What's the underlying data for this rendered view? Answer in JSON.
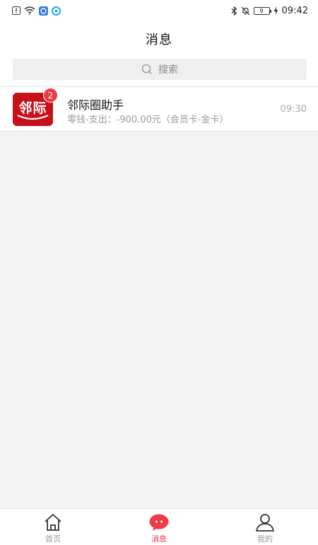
{
  "status_bar": {
    "time": "09:42",
    "battery": "9"
  },
  "header": {
    "title": "消息"
  },
  "search": {
    "placeholder": "搜索"
  },
  "messages": [
    {
      "avatar_text": "邻际",
      "badge": "2",
      "title": "邻际圈助手",
      "preview": "零钱-支出：-900.00元（会员卡-金卡）",
      "time": "09:30"
    }
  ],
  "tabs": [
    {
      "label": "首页",
      "icon": "home-icon",
      "active": false
    },
    {
      "label": "消息",
      "icon": "chat-bubble-icon",
      "active": true
    },
    {
      "label": "我的",
      "icon": "profile-icon",
      "active": false
    }
  ],
  "colors": {
    "accent": "#e63a45",
    "avatar_bg": "#c8101b"
  }
}
